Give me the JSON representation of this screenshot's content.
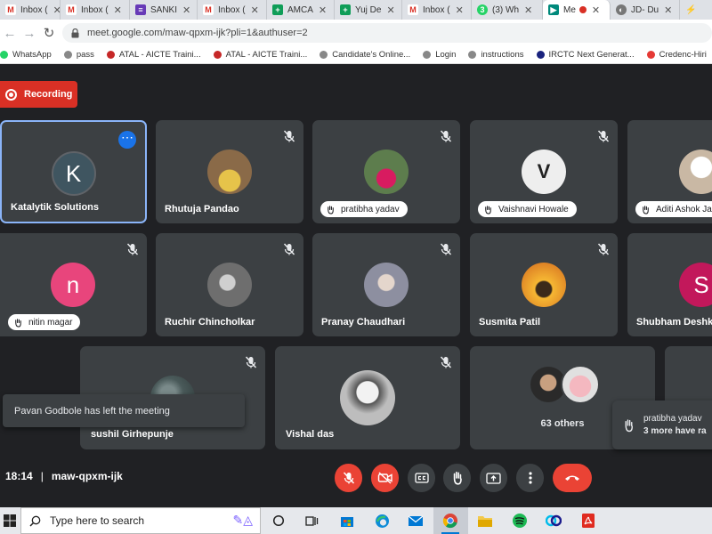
{
  "tabs": [
    {
      "label": "Inbox (",
      "icon": "gmail-icon"
    },
    {
      "label": "Inbox (",
      "icon": "gmail-icon"
    },
    {
      "label": "SANKI",
      "icon": "forms-icon"
    },
    {
      "label": "Inbox (",
      "icon": "gmail-icon"
    },
    {
      "label": "AMCA",
      "icon": "sheets-icon"
    },
    {
      "label": "Yuj De",
      "icon": "sheets-icon"
    },
    {
      "label": "Inbox (",
      "icon": "gmail-icon"
    },
    {
      "label": "(3) Wh",
      "icon": "whatsapp-icon"
    },
    {
      "label": "Me",
      "icon": "meet-icon"
    },
    {
      "label": "JD- Du",
      "icon": "globe-icon"
    }
  ],
  "url": "meet.google.com/maw-qpxm-ijk?pli=1&authuser=2",
  "bookmarks": [
    "WhatsApp",
    "pass",
    "ATAL - AICTE Traini...",
    "ATAL - AICTE Traini...",
    "Candidate's Online...",
    "Login",
    "instructions",
    "IRCTC Next Generat...",
    "Credenc-Hiri"
  ],
  "recording_label": "Recording",
  "participants_row1": [
    {
      "name": "Katalytik Solutions",
      "initial": "K",
      "avatar_color": "#3f5560",
      "pill": false
    },
    {
      "name": "Rhutuja Pandao",
      "initial": "",
      "avatar_color": "#8a6a48",
      "pill": false
    },
    {
      "name": "pratibha yadav",
      "initial": "",
      "avatar_color": "#5d7d4d",
      "pill": true
    },
    {
      "name": "Vaishnavi Howale",
      "initial": "V",
      "avatar_color": "#e9e9e9",
      "pill": true
    },
    {
      "name": "Aditi Ashok Ja",
      "initial": "",
      "avatar_color": "#c9b8a4",
      "pill": true
    }
  ],
  "participants_row2": [
    {
      "name": "nitin magar",
      "initial": "n",
      "avatar_color": "#e8457c",
      "pill": true
    },
    {
      "name": "Ruchir Chincholkar",
      "initial": "",
      "avatar_color": "#6e6e6e",
      "pill": false
    },
    {
      "name": "Pranay Chaudhari",
      "initial": "",
      "avatar_color": "#8d8fa0",
      "pill": false
    },
    {
      "name": "Susmita Patil",
      "initial": "",
      "avatar_color": "#e8a62a",
      "pill": false
    },
    {
      "name": "Shubham Deshk",
      "initial": "S",
      "avatar_color": "#c2185b",
      "pill": false
    }
  ],
  "participants_row3": [
    {
      "name": "sushil Girhepunje",
      "initial": "",
      "avatar_color": "#4a5a5a"
    },
    {
      "name": "Vishal das",
      "initial": "",
      "avatar_color": "#bdbdbd"
    }
  ],
  "others_label": "63 others",
  "toast": "Pavan Godbole has left the meeting",
  "raised_hand": {
    "name": "pratibha yadav",
    "more": "3 more have ra"
  },
  "meeting_time": "18:14",
  "meeting_code": "maw-qpxm-ijk",
  "taskbar_search": "Type here to search",
  "colors": {
    "red": "#ea4335",
    "tile": "#3c4043",
    "bg": "#202124",
    "accent": "#1a73e8"
  }
}
